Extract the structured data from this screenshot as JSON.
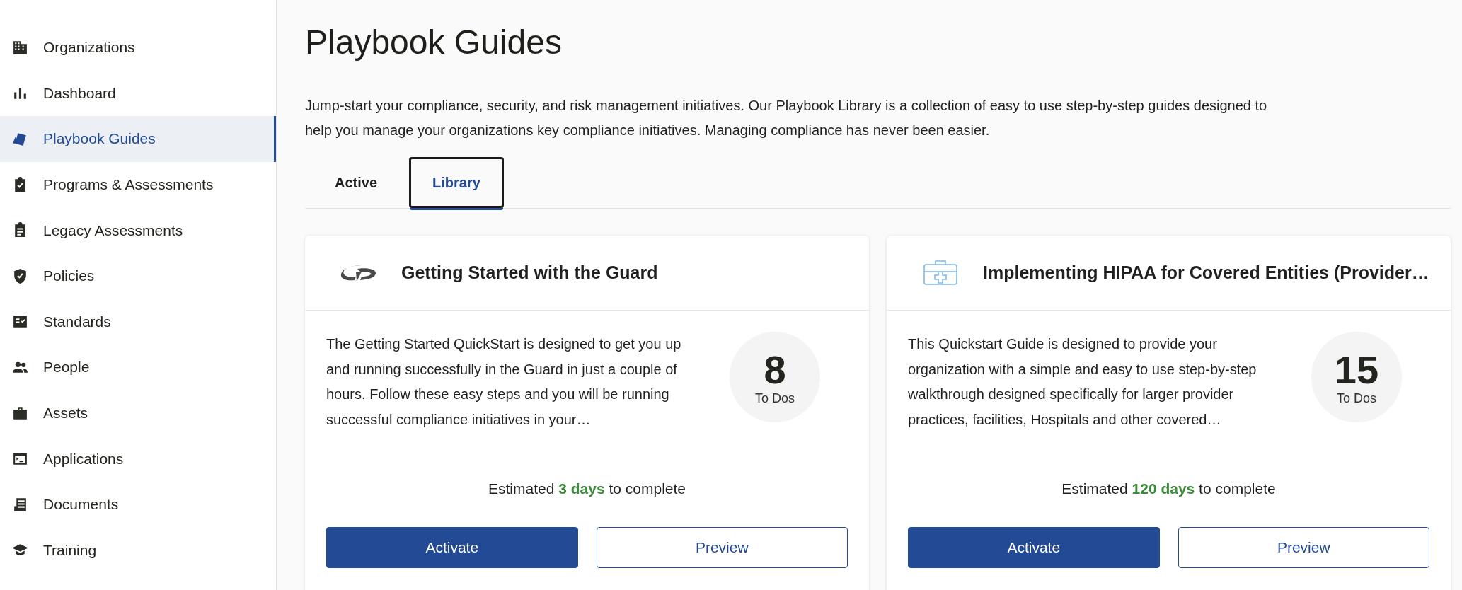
{
  "sidebar": {
    "items": [
      {
        "label": "Organizations",
        "selected": false
      },
      {
        "label": "Dashboard",
        "selected": false
      },
      {
        "label": "Playbook Guides",
        "selected": true
      },
      {
        "label": "Programs & Assessments",
        "selected": false
      },
      {
        "label": "Legacy Assessments",
        "selected": false
      },
      {
        "label": "Policies",
        "selected": false
      },
      {
        "label": "Standards",
        "selected": false
      },
      {
        "label": "People",
        "selected": false
      },
      {
        "label": "Assets",
        "selected": false
      },
      {
        "label": "Applications",
        "selected": false
      },
      {
        "label": "Documents",
        "selected": false
      },
      {
        "label": "Training",
        "selected": false
      }
    ]
  },
  "page": {
    "title": "Playbook Guides",
    "description": "Jump-start your compliance, security, and risk management initiatives. Our Playbook Library is a collection of easy to use step-by-step guides designed to help you manage your organizations key compliance initiatives. Managing compliance has never been easier."
  },
  "tabs": [
    {
      "label": "Active",
      "selected": false
    },
    {
      "label": "Library",
      "selected": true
    }
  ],
  "cards": [
    {
      "title": "Getting Started with the Guard",
      "description": "The Getting Started QuickStart is designed to get you up and running successfully in the Guard in just a couple of hours. Follow these easy steps and you will be running successful compliance initiatives in your…",
      "todo_count": "8",
      "todo_label": "To Dos",
      "estimate": "Estimated **3 days** to complete",
      "buttons": [
        "Activate",
        "Preview"
      ]
    },
    {
      "title": "Implementing HIPAA for Covered Entities (Provider…",
      "description": "This Quickstart Guide is designed to provide your organization with a simple and easy to use step-by-step walkthrough designed specifically for larger provider practices, facilities, Hospitals and other covered…",
      "todo_count": "15",
      "todo_label": "To Dos",
      "estimate": "Estimated **120 days** to complete",
      "buttons": [
        "Activate",
        "Preview"
      ]
    }
  ]
}
